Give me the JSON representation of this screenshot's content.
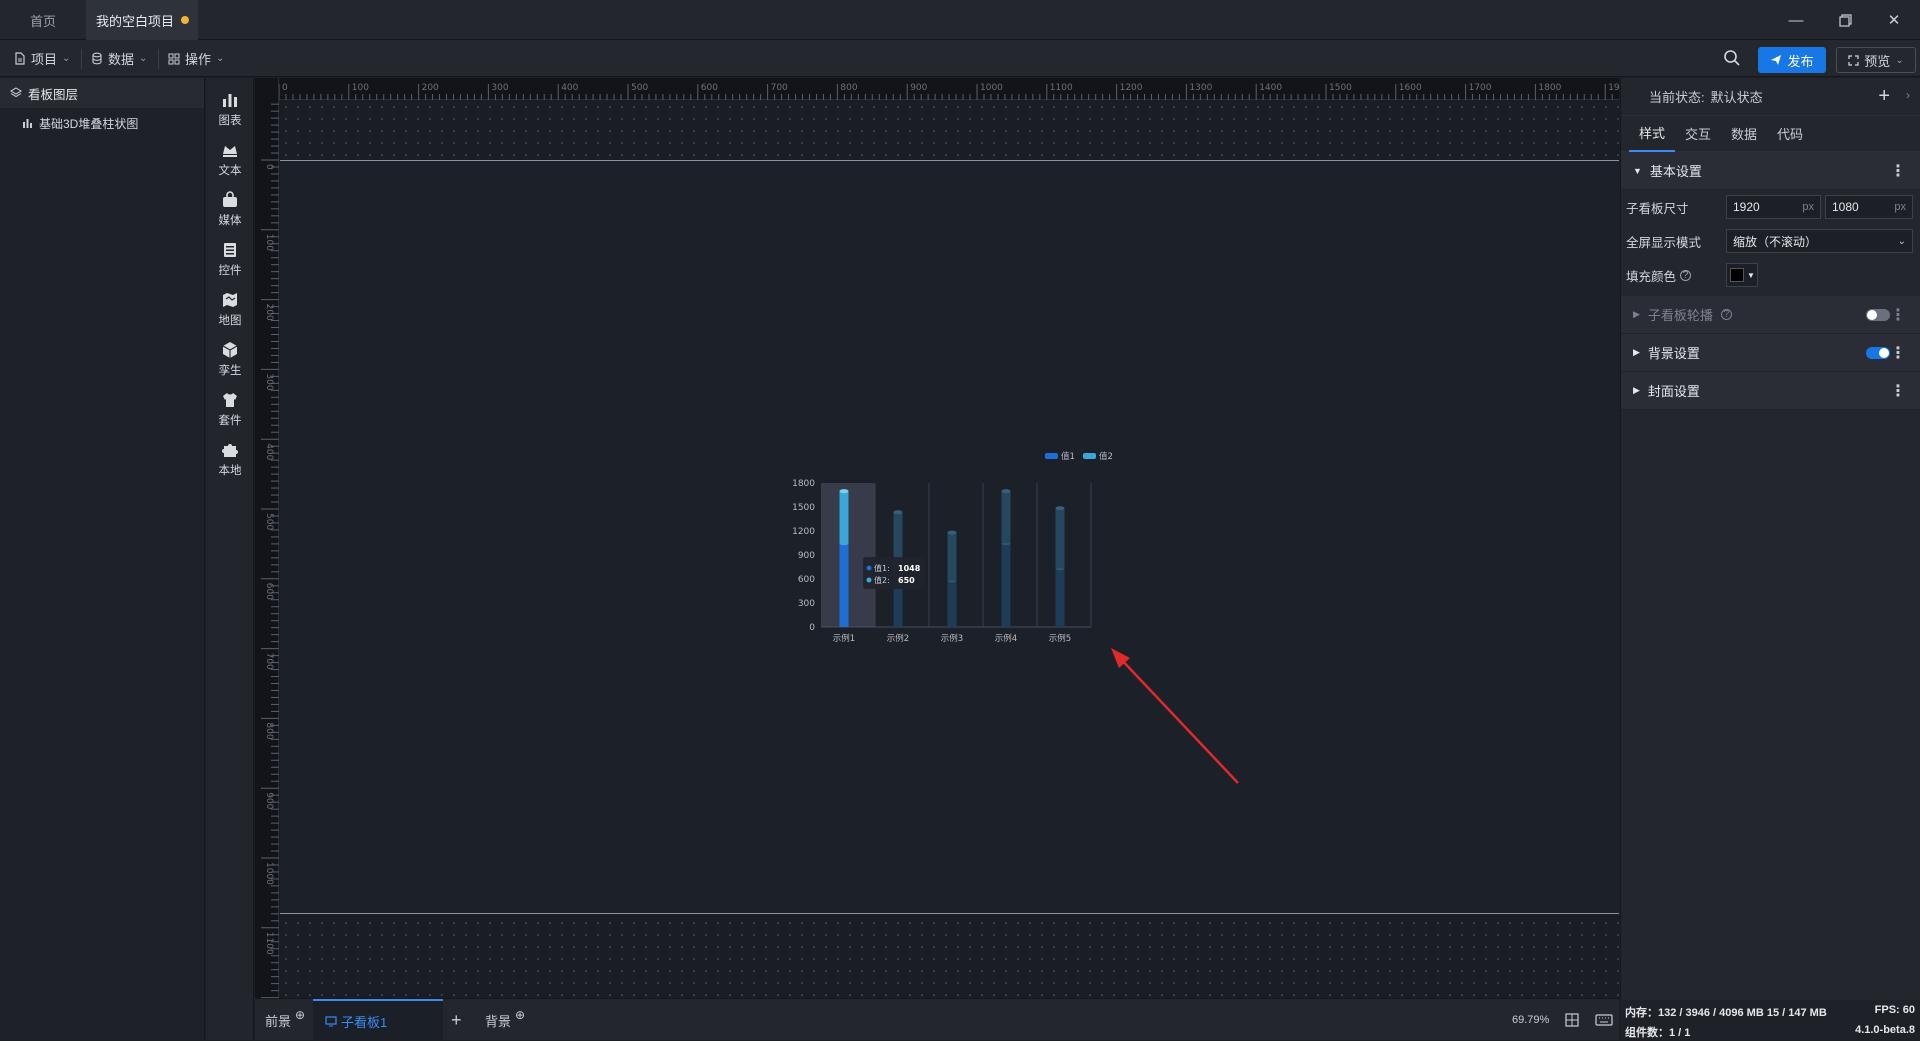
{
  "titlebar": {
    "tabs": [
      {
        "label": "首页"
      },
      {
        "label": "我的空白项目"
      }
    ],
    "window_controls": [
      "minimize-icon",
      "restore-icon",
      "close-icon"
    ]
  },
  "toolbar": {
    "menus": [
      {
        "label": "项目",
        "icon": "file-icon"
      },
      {
        "label": "数据",
        "icon": "database-icon"
      },
      {
        "label": "操作",
        "icon": "grid-icon"
      }
    ],
    "publish_label": "发布",
    "preview_label": "预览"
  },
  "layers": {
    "title": "看板图层",
    "items": [
      {
        "label": "基础3D堆叠柱状图"
      }
    ]
  },
  "toolbox": {
    "items": [
      {
        "label": "图表",
        "icon": "chart-icon"
      },
      {
        "label": "文本",
        "icon": "text-icon"
      },
      {
        "label": "媒体",
        "icon": "media-icon"
      },
      {
        "label": "控件",
        "icon": "control-icon"
      },
      {
        "label": "地图",
        "icon": "map-icon"
      },
      {
        "label": "孪生",
        "icon": "cube-icon"
      },
      {
        "label": "套件",
        "icon": "shirt-icon"
      },
      {
        "label": "本地",
        "icon": "puzzle-icon"
      }
    ]
  },
  "ruler": {
    "top_labels": [
      "0",
      "100",
      "200",
      "300",
      "400",
      "500",
      "600",
      "700",
      "800",
      "900",
      "1000",
      "1100",
      "1200",
      "1300",
      "1400",
      "1500",
      "1600",
      "1700",
      "1800",
      "1900"
    ],
    "left_labels": [
      "0",
      "100",
      "200",
      "300",
      "400",
      "500",
      "600",
      "700",
      "800",
      "900",
      "1000",
      "1100",
      "1200"
    ]
  },
  "chart_data": {
    "type": "bar",
    "stacked": true,
    "style": "3d-cylinder",
    "categories": [
      "示例1",
      "示例2",
      "示例3",
      "示例4",
      "示例5"
    ],
    "series": [
      {
        "name": "值1",
        "values": [
          1048,
          735,
          580,
          1048,
          735
        ],
        "color": "#1d6fd6"
      },
      {
        "name": "值2",
        "values": [
          650,
          700,
          600,
          650,
          750
        ],
        "color": "#3aa7d8"
      }
    ],
    "ylim": [
      0,
      1800
    ],
    "yticks": [
      "0",
      "300",
      "600",
      "900",
      "1200",
      "1500",
      "1800"
    ],
    "legend": "top-right",
    "tooltip": {
      "category_index": 0,
      "rows": [
        {
          "name": "值1",
          "value": "1048"
        },
        {
          "name": "值2",
          "value": "650"
        }
      ]
    }
  },
  "bottombar": {
    "tabs": [
      {
        "label": "前景"
      },
      {
        "label": "子看板1"
      },
      {
        "label": "背景"
      }
    ],
    "zoom": "69.79%"
  },
  "rpanel": {
    "state_label": "当前状态:",
    "state_value": "默认状态",
    "tabs": [
      "样式",
      "交互",
      "数据",
      "代码"
    ],
    "basic_section": "基本设置",
    "size_label": "子看板尺寸",
    "width": "1920",
    "height": "1080",
    "unit": "px",
    "fullscreen_label": "全屏显示模式",
    "fullscreen_value": "缩放（不滚动）",
    "fill_label": "填充颜色",
    "fill_color": "#000000",
    "carousel_section": "子看板轮播",
    "bg_section": "背景设置",
    "cover_section": "封面设置"
  },
  "status": {
    "memory": "内存：132 / 3946 / 4096 MB 15 / 147 MB",
    "fps": "FPS:  60",
    "components": "组件数：1 / 1",
    "version": "4.1.0-beta.8"
  }
}
